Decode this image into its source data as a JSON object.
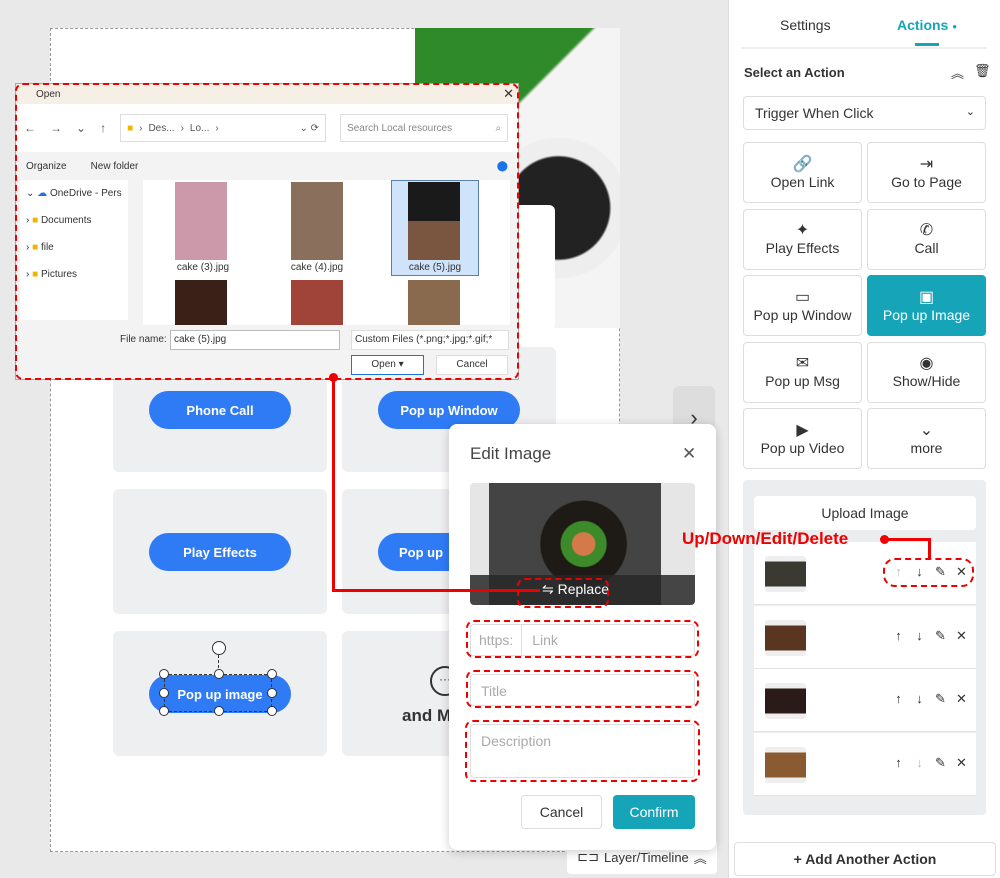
{
  "canvas": {
    "buttons": [
      "Phone Call",
      "Pop up Window",
      "Play Effects",
      "Pop up",
      "Pop up image"
    ],
    "more_text": "and M",
    "layer_label": "Layer/Timeline"
  },
  "open_dialog": {
    "title": "Open",
    "path": [
      "Des...",
      "Lo..."
    ],
    "search_placeholder": "Search Local resources",
    "organize": "Organize",
    "new_folder": "New folder",
    "tree": [
      {
        "label": "OneDrive - Pers"
      },
      {
        "label": "Documents"
      },
      {
        "label": "file"
      },
      {
        "label": "Pictures"
      }
    ],
    "files": [
      "cake (3).jpg",
      "cake (4).jpg",
      "cake (5).jpg"
    ],
    "selected_file": "cake (5).jpg",
    "file_name_label": "File name:",
    "file_name": "cake (5).jpg",
    "filter": "Custom Files (*.png;*.jpg;*.gif;*",
    "open": "Open",
    "cancel": "Cancel"
  },
  "edit_image": {
    "title": "Edit Image",
    "replace": "Replace",
    "prefix": "https:",
    "link_placeholder": "Link",
    "title_placeholder": "Title",
    "description_placeholder": "Description",
    "cancel": "Cancel",
    "confirm": "Confirm"
  },
  "annotation": {
    "label": "Up/Down/Edit/Delete",
    "color": "#e00000"
  },
  "panel": {
    "tabs": [
      "Settings",
      "Actions"
    ],
    "active_tab": "Actions",
    "section_title": "Select an Action",
    "trigger": "Trigger When Click",
    "actions": [
      {
        "label": "Open Link",
        "icon": "link-icon"
      },
      {
        "label": "Go to Page",
        "icon": "enter-icon"
      },
      {
        "label": "Play Effects",
        "icon": "sparkle-icon"
      },
      {
        "label": "Call",
        "icon": "phone-icon"
      },
      {
        "label": "Pop up Window",
        "icon": "window-icon"
      },
      {
        "label": "Pop up Image",
        "icon": "image-icon",
        "selected": true
      },
      {
        "label": "Pop up Msg",
        "icon": "envelope-icon"
      },
      {
        "label": "Show/Hide",
        "icon": "eye-icon"
      },
      {
        "label": "Pop up Video",
        "icon": "play-icon"
      },
      {
        "label": "more",
        "icon": "chevron-circle-icon"
      }
    ],
    "upload": "Upload Image",
    "image_count": 4,
    "add_action": "Add Another Action",
    "accent": "#16a5b8"
  }
}
